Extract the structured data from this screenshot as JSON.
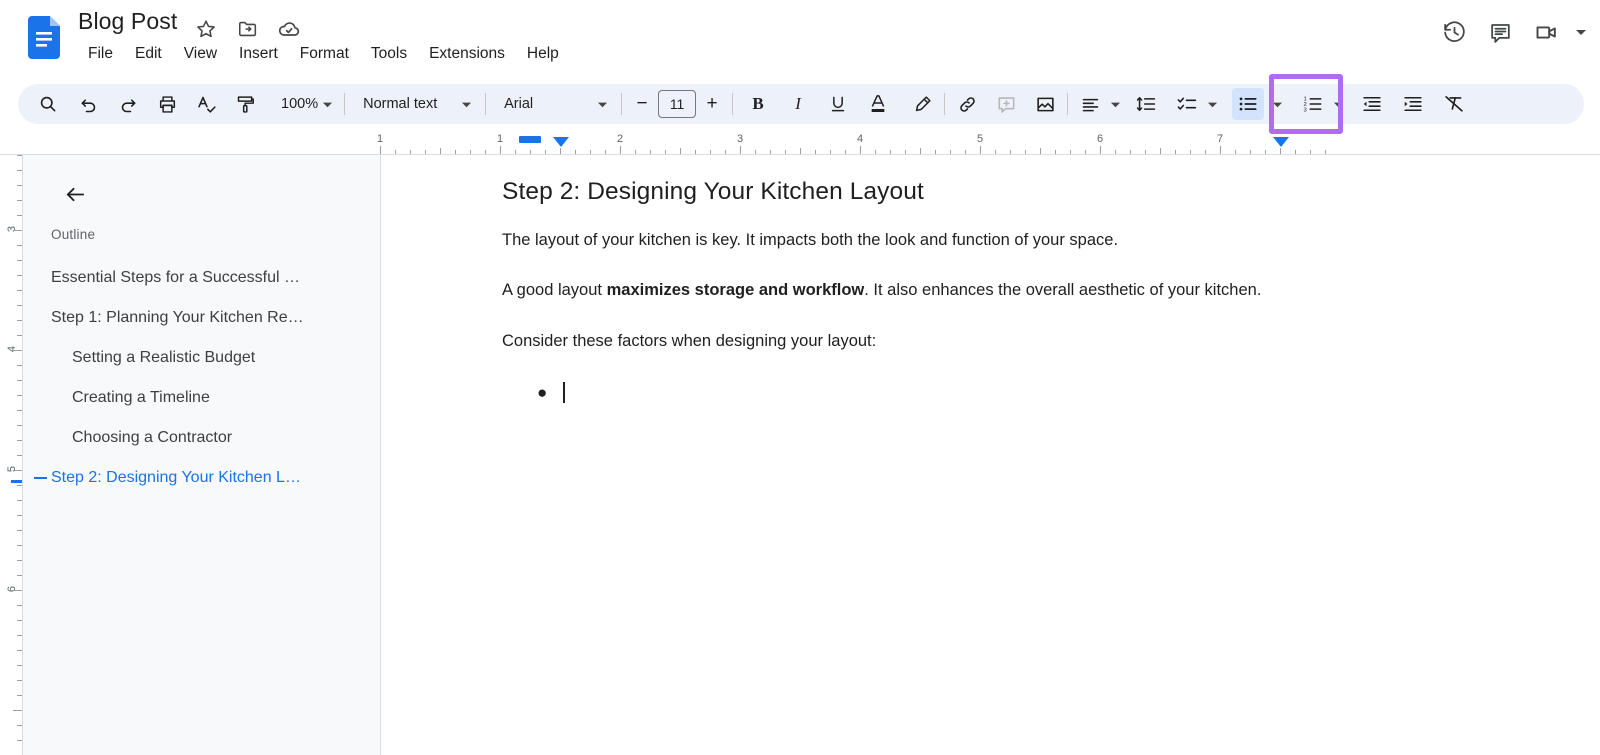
{
  "app": {
    "name": "Google Docs",
    "logo_icon": "docs-file-icon"
  },
  "header": {
    "doc_title": "Blog Post",
    "icons": [
      {
        "name": "star-icon",
        "label": "Star"
      },
      {
        "name": "move-folder-icon",
        "label": "Move"
      },
      {
        "name": "cloud-saved-icon",
        "label": "Saved to Drive"
      }
    ],
    "menus": [
      "File",
      "Edit",
      "View",
      "Insert",
      "Format",
      "Tools",
      "Extensions",
      "Help"
    ],
    "right_icons": [
      {
        "name": "version-history-icon",
        "label": "Version history"
      },
      {
        "name": "comment-history-icon",
        "label": "Open comment history"
      },
      {
        "name": "meet-camera-icon",
        "label": "Join a call"
      },
      {
        "name": "chevron-down-icon",
        "label": "Meet options"
      }
    ]
  },
  "toolbar": {
    "search_label": "Search",
    "undo_label": "Undo",
    "redo_label": "Redo",
    "print_label": "Print",
    "spellcheck_label": "Spelling and grammar check",
    "paint_format_label": "Paint format",
    "zoom_value": "100%",
    "style_value": "Normal text",
    "font_value": "Arial",
    "font_size_value": "11",
    "decrease_font_label": "−",
    "increase_font_label": "+",
    "bold_label": "B",
    "italic_label": "I",
    "underline_label": "U",
    "text_color_label": "A",
    "highlight_label": "Highlight color",
    "link_label": "Insert link",
    "comment_label": "Add comment",
    "image_label": "Insert image",
    "align_label": "Align",
    "line_spacing_label": "Line & paragraph spacing",
    "checklist_label": "Checklist",
    "bulleted_list_label": "Bulleted list",
    "numbered_list_label": "Numbered list",
    "decrease_indent_label": "Decrease indent",
    "increase_indent_label": "Increase indent",
    "clear_formatting_label": "Clear formatting",
    "active_button": "bulleted-list",
    "highlight_color": "#b06cf0",
    "active_bg_color": "#d3e3fd"
  },
  "ruler": {
    "horizontal_numbers": [
      "1",
      "1",
      "2",
      "3",
      "4",
      "5",
      "6",
      "7"
    ],
    "vertical_numbers": [
      "3",
      "4",
      "5",
      "6"
    ],
    "indent_marker_color": "#1a73e8"
  },
  "outline": {
    "panel_title": "Outline",
    "back_label": "Close document outline",
    "items": [
      {
        "label": "Essential Steps for a Successful …",
        "level": 1,
        "active": false
      },
      {
        "label": "Step 1: Planning Your Kitchen Re…",
        "level": 1,
        "active": false
      },
      {
        "label": "Setting a Realistic Budget",
        "level": 2,
        "active": false
      },
      {
        "label": "Creating a Timeline",
        "level": 2,
        "active": false
      },
      {
        "label": "Choosing a Contractor",
        "level": 2,
        "active": false
      },
      {
        "label": "Step 2: Designing Your Kitchen L…",
        "level": 1,
        "active": true
      }
    ],
    "active_color": "#1a73e8"
  },
  "document": {
    "heading": "Step 2: Designing Your Kitchen Layout",
    "paragraph_1": "The layout of your kitchen is key. It impacts both the look and function of your space.",
    "paragraph_2_pre": "A good layout ",
    "paragraph_2_bold": "maximizes storage and workflow",
    "paragraph_2_post": ". It also enhances the overall aesthetic of your kitchen.",
    "paragraph_3": "Consider these factors when designing your layout:",
    "bullet_glyph": "●",
    "bullet_text": ""
  }
}
